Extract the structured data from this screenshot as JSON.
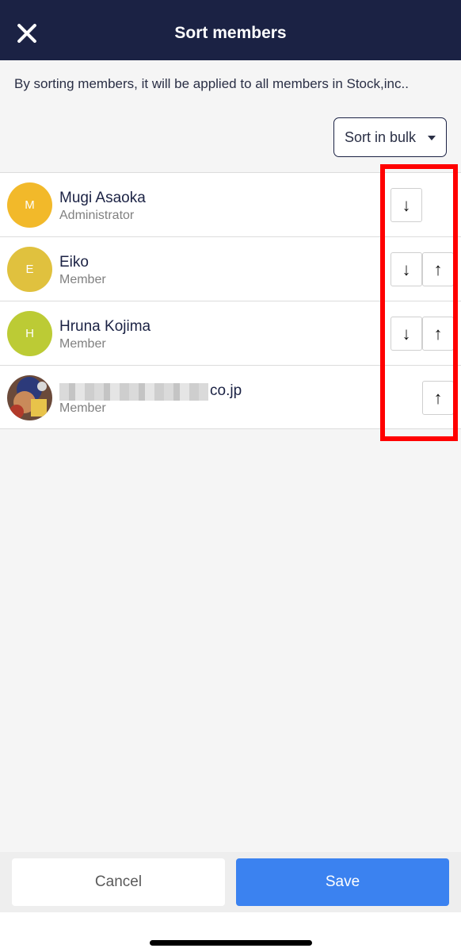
{
  "header": {
    "title": "Sort members",
    "close_icon": "close-icon"
  },
  "description": "By sorting members, it will be applied to all members in Stock,inc..",
  "bulk_sort": {
    "label": "Sort in bulk",
    "icon": "caret-down-icon"
  },
  "members": [
    {
      "initial": "M",
      "name": "Mugi Asaoka",
      "role": "Administrator",
      "avatar_color": "#f2b92a",
      "can_move_down": true,
      "can_move_up": false
    },
    {
      "initial": "E",
      "name": "Eiko",
      "role": "Member",
      "avatar_color": "#e0c13e",
      "can_move_down": true,
      "can_move_up": true
    },
    {
      "initial": "H",
      "name": "Hruna Kojima",
      "role": "Member",
      "avatar_color": "#bccb35",
      "can_move_down": true,
      "can_move_up": true
    },
    {
      "initial": "",
      "name": "co.jp",
      "role": "Member",
      "avatar_color": "#6b4a3a",
      "can_move_down": false,
      "can_move_up": true
    }
  ],
  "sort_buttons": {
    "down_symbol": "↓",
    "up_symbol": "↑"
  },
  "footer": {
    "cancel_label": "Cancel",
    "save_label": "Save"
  },
  "colors": {
    "header_bg": "#1b2244",
    "save_bg": "#3b82f0",
    "highlight": "#ff0000"
  }
}
